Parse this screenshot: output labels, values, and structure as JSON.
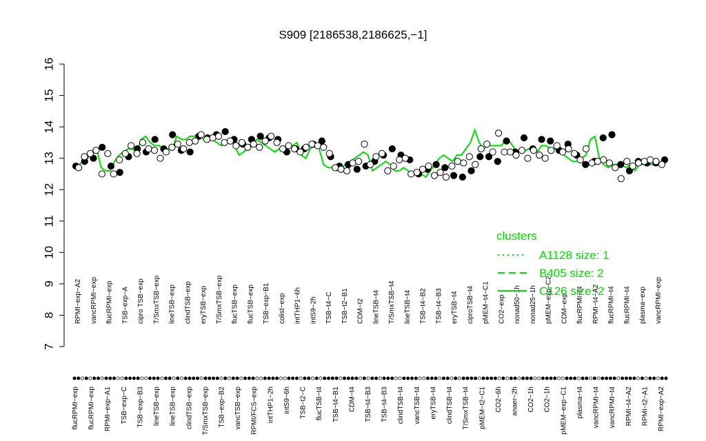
{
  "chart_data": {
    "type": "line",
    "title": "S909 [2186538,2186625,−1]",
    "xlabel": "",
    "ylabel": "",
    "ylim": [
      7,
      16
    ],
    "yticks": [
      7,
      8,
      9,
      10,
      11,
      12,
      13,
      14,
      15,
      16
    ],
    "grid": false,
    "legend": {
      "title": "clusters",
      "placement": "right",
      "entries": [
        {
          "label": "A1128 size: 1",
          "style": "dotted"
        },
        {
          "label": "B405 size: 2",
          "style": "dashed"
        },
        {
          "label": "C126 size: 2",
          "style": "solid"
        }
      ]
    },
    "line_color": "#00dd00",
    "top_labels": [
      "RPMI−exp−A2",
      "vancRPMI−exp",
      "flucRPMI−exp",
      "TSB−exp−A",
      "cipro TSB−exp",
      "T/SmxTSB−exp",
      "lineTSB−exp",
      "clindTSB−exp",
      "eryTSB−exp",
      "T/SmxTSB−exp",
      "flucTSB−exp",
      "flucTSB−exp",
      "TSB−exp−B1",
      "colist−exp",
      "intTHP1−6h",
      "intS9−2h",
      "TSB−t4−C",
      "TSB−t2−B1",
      "CDM−t2",
      "lineTSB−t4",
      "T/SmxTSB−t4",
      "lineTSB−t4",
      "TSB−t4−B2",
      "TSB−t4−B3",
      "eryTSB−t4",
      "ciproTSB−t4",
      "pMEM−t4−C1",
      "CO2−exp",
      "nonad50−1h",
      "nonad25−1h",
      "pMEM−exp−C2",
      "CDM−exp",
      "flucRPMI−t4",
      "RPMI−t4−A2",
      "flucRPMI−t4",
      "flucRPMI−t4",
      "plasma−exp",
      "vancRPMI−exp"
    ],
    "bottom_labels": [
      "flucRPMI−exp",
      "flucRPMI−exp",
      "RPMI−exp−A1",
      "TSB−exp−C",
      "TSB−exp−B3",
      "lineTSB−exp",
      "lineTSB−exp",
      "clindTSB−exp",
      "T/SmxTSB−exp",
      "TSB−exp−B2",
      "vancTSB−exp",
      "RPMI/FCS−exp",
      "intTHP1−2h",
      "intS9−6h",
      "TSB−t2−C",
      "flucTSB−t4",
      "TSB−t4−B1",
      "CDM−t4",
      "TSB−t4−B3",
      "TSB−t4−B3",
      "clindTSB−t4",
      "vancTSB−t4",
      "eryTSB−t4",
      "clindTSB−t4",
      "T/SmxTSB−t4",
      "pMEM−t2−C1",
      "CO2−6h",
      "anaer−2h",
      "CO2−1h",
      "CO2−1h",
      "pMEM−exp−C1",
      "plasma−t4",
      "vancRPMI−t4",
      "vancRPMI−t4",
      "RPMI−t4−A2",
      "RPMI−t2−A1",
      "RPMI−exp−A2"
    ],
    "series": [
      {
        "values": [
          12.7,
          12.8,
          12.9,
          13.0,
          13.2,
          13.3,
          12.7,
          12.6,
          12.6,
          12.9,
          13.1,
          13.2,
          13.3,
          13.3,
          13.2,
          13.6,
          13.7,
          13.5,
          13.4,
          13.4,
          13.3,
          13.3,
          13.3,
          13.7,
          13.6,
          13.6,
          13.7,
          13.7,
          13.8,
          13.6,
          13.7,
          13.6,
          13.5,
          13.4,
          13.5,
          13.6,
          13.4,
          13.1,
          13.2,
          13.3,
          13.4,
          13.6,
          13.5,
          13.4,
          13.3,
          13.2,
          13.3,
          13.2,
          13.4,
          13.4,
          13.5,
          13.1,
          13.0,
          13.3,
          13.4,
          13.3,
          12.8,
          12.7,
          12.7,
          12.6,
          12.7,
          12.8,
          12.9,
          13.0,
          13.1,
          13.2,
          13.1,
          12.6,
          12.7,
          12.8,
          12.9,
          12.8,
          12.6,
          12.6,
          12.7,
          12.6,
          12.5,
          12.5,
          12.5,
          12.4,
          12.6,
          12.8,
          13.0,
          13.1,
          13.0,
          12.9,
          13.1,
          13.1,
          13.3,
          13.5,
          13.9,
          13.5,
          13.3,
          13.4,
          13.4,
          13.4,
          13.4,
          13.6,
          13.5,
          13.3,
          13.2,
          13.2,
          13.3,
          13.3,
          13.2,
          13.4,
          13.4,
          13.3,
          13.3,
          13.2,
          13.1,
          13.0,
          12.9,
          12.9,
          13.0,
          13.1,
          13.6,
          13.7,
          13.0,
          12.8,
          12.7,
          12.8,
          12.8,
          12.8,
          12.7,
          12.8,
          12.6,
          12.8,
          12.8,
          12.8,
          12.8,
          12.8,
          12.9,
          12.9
        ],
        "points_filled": [
          12.75,
          12.9,
          13.0,
          13.35,
          12.75,
          12.55,
          13.05,
          13.3,
          13.2,
          13.6,
          13.3,
          13.75,
          13.25,
          13.2,
          13.7,
          13.65,
          13.75,
          13.85,
          13.6,
          13.45,
          13.6,
          13.7,
          13.65,
          13.6,
          13.2,
          13.3,
          13.3,
          13.45,
          13.55,
          13.05,
          12.75,
          12.8,
          12.65,
          12.75,
          12.9,
          13.1,
          13.3,
          13.1,
          12.95,
          12.5,
          12.65,
          12.8,
          12.7,
          12.45,
          12.4,
          12.6,
          13.05,
          13.05,
          12.9,
          13.55,
          13.2,
          13.65,
          13.3,
          13.6,
          13.55,
          13.25,
          13.45,
          13.1,
          12.8,
          12.9,
          13.65,
          13.75,
          12.8,
          12.6,
          12.9,
          12.85,
          12.85,
          12.95
        ],
        "points_open": [
          12.7,
          13.05,
          13.15,
          13.25,
          12.5,
          13.15,
          12.5,
          12.95,
          13.15,
          13.4,
          13.15,
          13.5,
          13.3,
          13.25,
          13.0,
          13.2,
          13.35,
          13.45,
          13.3,
          13.5,
          13.55,
          13.75,
          13.6,
          13.65,
          13.7,
          13.5,
          13.55,
          13.4,
          13.5,
          13.35,
          13.45,
          13.35,
          13.55,
          13.7,
          13.5,
          13.3,
          13.4,
          13.3,
          13.2,
          13.35,
          13.45,
          13.4,
          13.35,
          13.15,
          12.7,
          12.65,
          12.6,
          12.85,
          12.9,
          13.45,
          12.8,
          13.05,
          13.15,
          12.6,
          12.75,
          12.95,
          13.0,
          12.5,
          12.55,
          12.65,
          12.75,
          12.45,
          12.55,
          12.4,
          12.75,
          12.9,
          12.85,
          13.05,
          12.8,
          13.3,
          13.45,
          13.2,
          13.8,
          13.2,
          13.2,
          13.1,
          13.25,
          13.0,
          13.25,
          13.1,
          13.0,
          13.25,
          13.4,
          13.2,
          13.3,
          13.15,
          12.95,
          13.3,
          12.85,
          12.9,
          12.95,
          12.85,
          12.7,
          12.35,
          12.9,
          12.75,
          12.85,
          12.9,
          12.95,
          12.9,
          12.8
        ]
      }
    ]
  }
}
